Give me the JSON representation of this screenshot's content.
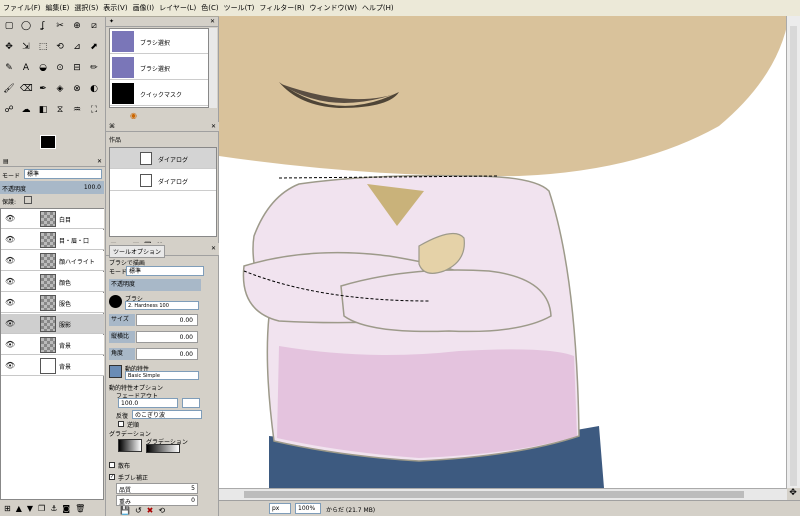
{
  "menubar": [
    "ファイル(F)",
    "編集(E)",
    "選択(S)",
    "表示(V)",
    "画像(I)",
    "レイヤー(L)",
    "色(C)",
    "ツール(T)",
    "フィルター(R)",
    "ウィンドウ(W)",
    "ヘルプ(H)"
  ],
  "toolbox": {
    "tools": [
      "▢",
      "◯",
      "ʆ",
      "✂",
      "⊕",
      "⧄",
      "✥",
      "⇲",
      "⬚",
      "⟲",
      "⊿",
      "⬈",
      "✎",
      "A",
      "◒",
      "⊙",
      "⊟",
      "✏",
      "🖌",
      "⌫",
      "✒",
      "◈",
      "⊗",
      "◐",
      "☍",
      "☁",
      "◧",
      "⧖",
      "♒",
      "⛶"
    ]
  },
  "layers_panel": {
    "mode_label": "モード",
    "mode_value": "標準",
    "opacity_label": "不透明度",
    "opacity_value": "100.0",
    "lock_label": "保護:",
    "layers": [
      {
        "name": "白目",
        "selected": false,
        "white": false
      },
      {
        "name": "目・眉・口",
        "selected": false,
        "white": false
      },
      {
        "name": "顔ハイライト",
        "selected": false,
        "white": false
      },
      {
        "name": "顔色",
        "selected": false,
        "white": false
      },
      {
        "name": "服色",
        "selected": false,
        "white": false
      },
      {
        "name": "服影",
        "selected": true,
        "white": false
      },
      {
        "name": "背景",
        "selected": false,
        "white": false
      },
      {
        "name": "背景",
        "selected": false,
        "white": true
      }
    ]
  },
  "brushes_panel": {
    "items": [
      "ブラシ選択",
      "ブラシ選択",
      "クイックマスク"
    ]
  },
  "paths_panel": {
    "title": "作品",
    "items": [
      "ダイアログ",
      "ダイアログ"
    ]
  },
  "tool_options": {
    "tab_label": "ツールオプション",
    "title": "ブラシで描画",
    "mode_label": "モード",
    "mode_value": "標準",
    "opacity_label": "不透明度",
    "brush_label": "ブラシ",
    "brush_value": "2. Hardness 100",
    "size_label": "サイズ",
    "size_value": "0.00",
    "aspect_label": "縦横比",
    "aspect_value": "0.00",
    "angle_label": "角度",
    "angle_value": "0.00",
    "dynamics_label": "動的特性",
    "dynamics_value": "Basic Simple",
    "dynamics_options_label": "動的特性オプション",
    "fade_label": "フェードアウト",
    "fade_value": "100.0",
    "repeat_label": "反復",
    "repeat_value": "のこぎり波",
    "reverse_label": "逆順",
    "gradient_label": "グラデーション",
    "gradient_option": "グラデーション",
    "jitter_label": "散布",
    "smooth_label": "手ブレ補正",
    "quality_label": "品質",
    "quality_value": "5",
    "weight_label": "重み",
    "weight_value": "0"
  },
  "status": {
    "unit": "px",
    "zoom": "100%",
    "message": "からだ (21.7 MB)"
  },
  "colors": {
    "head": "#d9c29b",
    "shirt": "#f1e3ef",
    "shirt_shadow": "#d9a9d0",
    "pants": "#3d5a80",
    "outline": "#9d9a8a"
  }
}
